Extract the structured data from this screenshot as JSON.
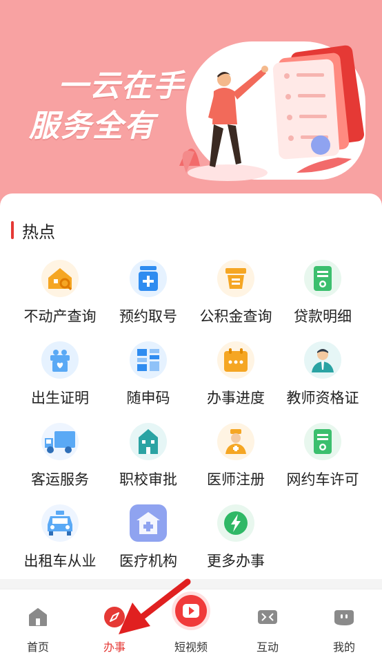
{
  "banner": {
    "line1": "一云在手",
    "line2": "服务全有"
  },
  "hot": {
    "title": "热点",
    "items": [
      {
        "label": "不动产查询",
        "icon": "house-search-icon"
      },
      {
        "label": "预约取号",
        "icon": "ticket-icon"
      },
      {
        "label": "公积金查询",
        "icon": "fund-box-icon"
      },
      {
        "label": "贷款明细",
        "icon": "document-icon"
      },
      {
        "label": "出生证明",
        "icon": "baby-gift-icon"
      },
      {
        "label": "随申码",
        "icon": "qr-grid-icon"
      },
      {
        "label": "办事进度",
        "icon": "calendar-icon"
      },
      {
        "label": "教师资格证",
        "icon": "teacher-icon"
      },
      {
        "label": "客运服务",
        "icon": "truck-icon"
      },
      {
        "label": "职校审批",
        "icon": "school-icon"
      },
      {
        "label": "医师注册",
        "icon": "doctor-icon"
      },
      {
        "label": "网约车许可",
        "icon": "document-icon"
      },
      {
        "label": "出租车从业",
        "icon": "taxi-icon"
      },
      {
        "label": "医疗机构",
        "icon": "hospital-icon"
      },
      {
        "label": "更多办事",
        "icon": "lightning-icon"
      }
    ]
  },
  "tabs": [
    {
      "label": "首页",
      "icon": "home-icon"
    },
    {
      "label": "办事",
      "icon": "compass-icon",
      "active": true
    },
    {
      "label": "短视频",
      "icon": "play-icon"
    },
    {
      "label": "互动",
      "icon": "interact-icon"
    },
    {
      "label": "我的",
      "icon": "user-icon"
    }
  ],
  "colors": {
    "banner": "#f8a2a2",
    "accent": "#e53935"
  }
}
